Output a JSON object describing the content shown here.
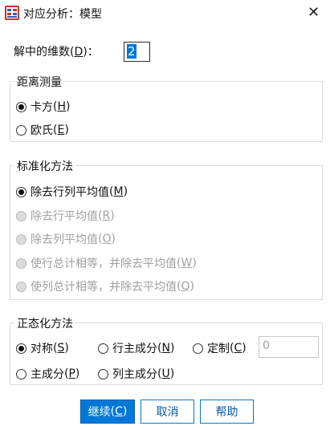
{
  "window": {
    "title": "对应分析：模型",
    "close_glyph": "✕"
  },
  "dimensions": {
    "label": "解中的维数",
    "mnemonic": "D",
    "suffix": "：",
    "value": "2"
  },
  "distance": {
    "title": "距离测量",
    "options": [
      {
        "label": "卡方",
        "mnemonic": "H",
        "checked": true,
        "enabled": true
      },
      {
        "label": "欧氏",
        "mnemonic": "E",
        "checked": false,
        "enabled": true
      }
    ]
  },
  "standardization": {
    "title": "标准化方法",
    "options": [
      {
        "label": "除去行列平均值",
        "mnemonic": "M",
        "checked": true,
        "enabled": true
      },
      {
        "label": "除去行平均值",
        "mnemonic": "R",
        "checked": false,
        "enabled": false
      },
      {
        "label": "除去列平均值",
        "mnemonic": "O",
        "checked": false,
        "enabled": false
      },
      {
        "label": "使行总计相等，并除去平均值",
        "mnemonic": "W",
        "checked": false,
        "enabled": false
      },
      {
        "label": "使列总计相等，并除去平均值",
        "mnemonic": "Q",
        "checked": false,
        "enabled": false
      }
    ]
  },
  "normalization": {
    "title": "正态化方法",
    "options": [
      {
        "label": "对称",
        "mnemonic": "S",
        "checked": true
      },
      {
        "label": "行主成分",
        "mnemonic": "N",
        "checked": false
      },
      {
        "label": "定制",
        "mnemonic": "C",
        "checked": false
      },
      {
        "label": "主成分",
        "mnemonic": "P",
        "checked": false
      },
      {
        "label": "列主成分",
        "mnemonic": "U",
        "checked": false
      }
    ],
    "custom_value": "0"
  },
  "buttons": {
    "continue": {
      "label": "继续",
      "mnemonic": "C"
    },
    "cancel": {
      "label": "取消"
    },
    "help": {
      "label": "帮助"
    }
  },
  "colors": {
    "accent": "#0078d7",
    "disabled_text": "#a0a0a0"
  }
}
